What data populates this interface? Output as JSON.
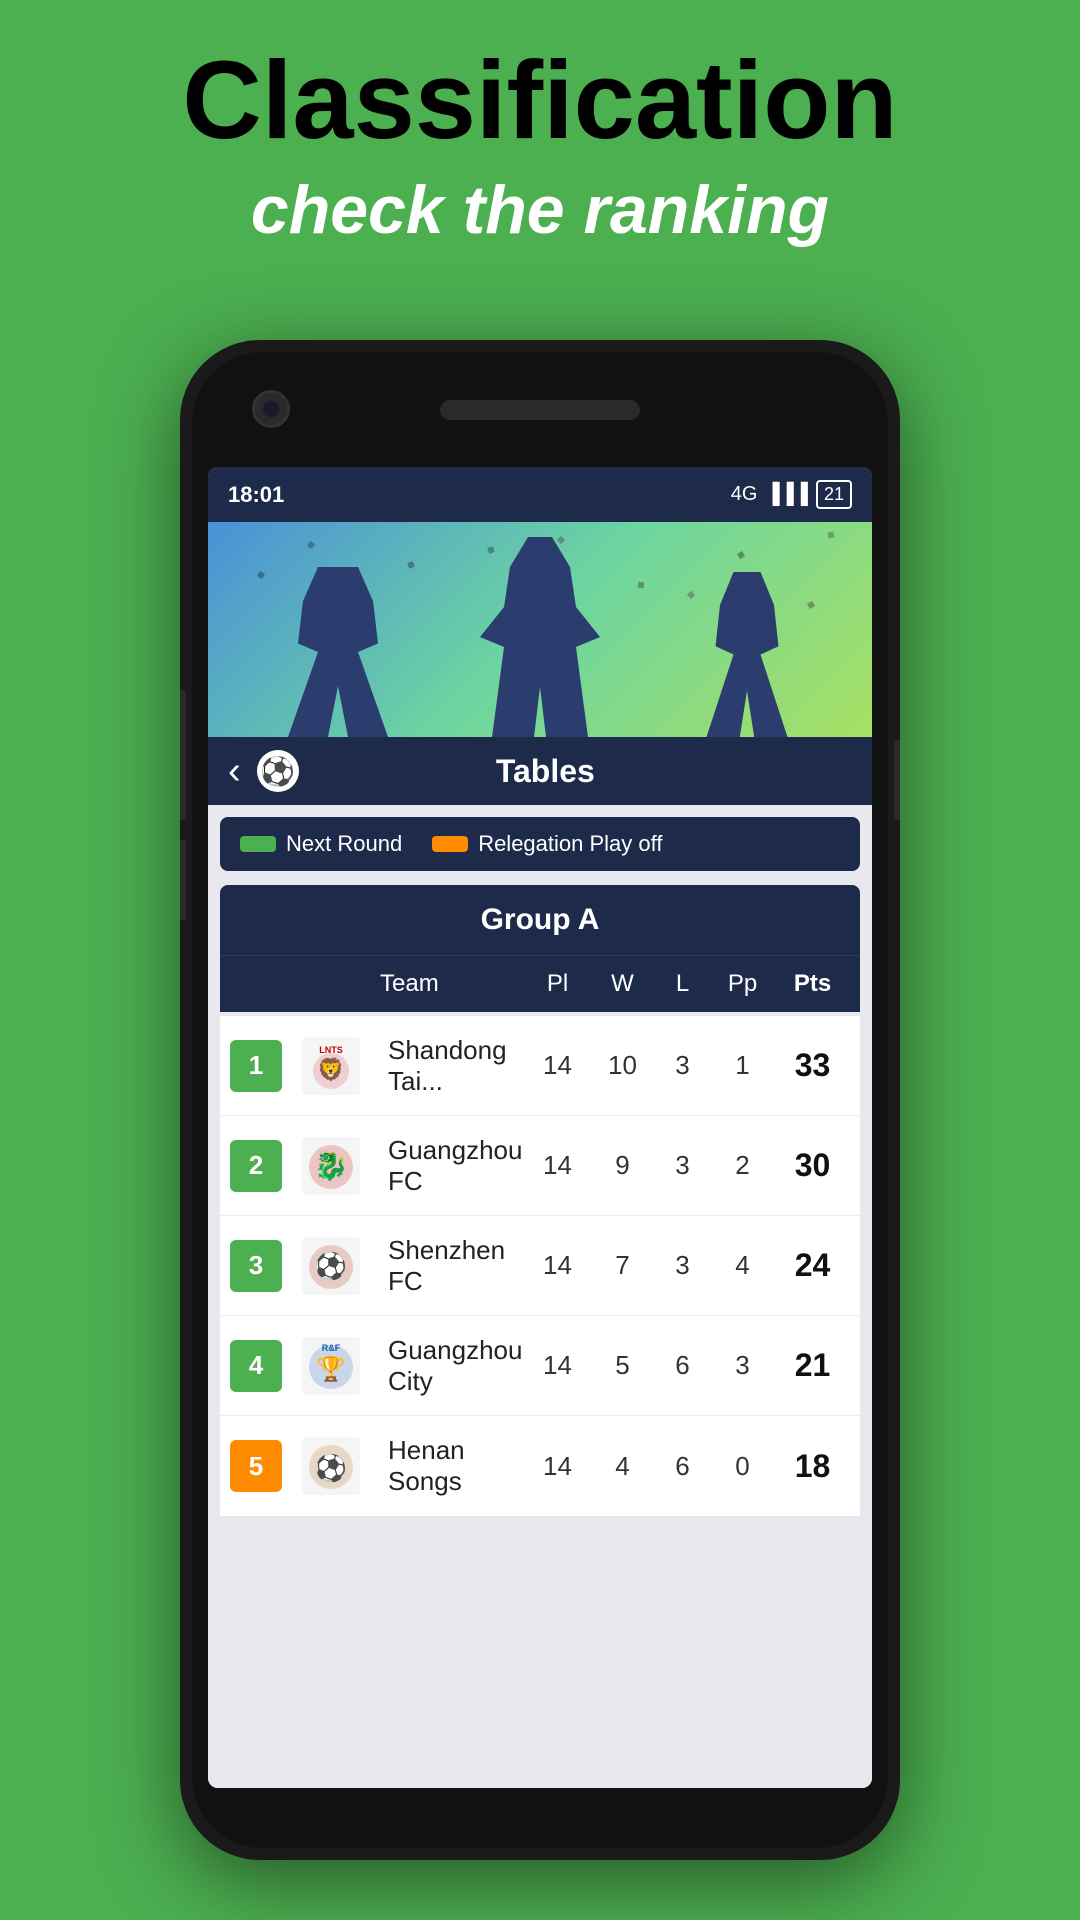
{
  "page": {
    "background_color": "#4caf50",
    "header": {
      "title": "Classification",
      "subtitle": "check the ranking"
    }
  },
  "phone": {
    "status_bar": {
      "time": "18:01",
      "signal": "4G",
      "battery": "21"
    },
    "nav": {
      "title": "Tables"
    },
    "legend": [
      {
        "label": "Next Round",
        "color": "green"
      },
      {
        "label": "Relegation Play off",
        "color": "orange"
      }
    ],
    "group": {
      "name": "Group A",
      "columns": {
        "team": "Team",
        "pl": "Pl",
        "w": "W",
        "l": "L",
        "pp": "Pp",
        "pts": "Pts"
      },
      "rows": [
        {
          "rank": 1,
          "rank_color": "green",
          "team_name": "Shandong Tai...",
          "pl": 14,
          "w": 10,
          "l": 3,
          "pp": 1,
          "pts": 33
        },
        {
          "rank": 2,
          "rank_color": "green",
          "team_name": "Guangzhou FC",
          "pl": 14,
          "w": 9,
          "l": 3,
          "pp": 2,
          "pts": 30
        },
        {
          "rank": 3,
          "rank_color": "green",
          "team_name": "Shenzhen FC",
          "pl": 14,
          "w": 7,
          "l": 3,
          "pp": 4,
          "pts": 24
        },
        {
          "rank": 4,
          "rank_color": "green",
          "team_name": "Guangzhou City",
          "pl": 14,
          "w": 5,
          "l": 6,
          "pp": 3,
          "pts": 21
        },
        {
          "rank": 5,
          "rank_color": "orange",
          "team_name": "Henan Songs",
          "pl": 14,
          "w": 4,
          "l": 6,
          "pp": 0,
          "pts": 18
        }
      ]
    }
  }
}
